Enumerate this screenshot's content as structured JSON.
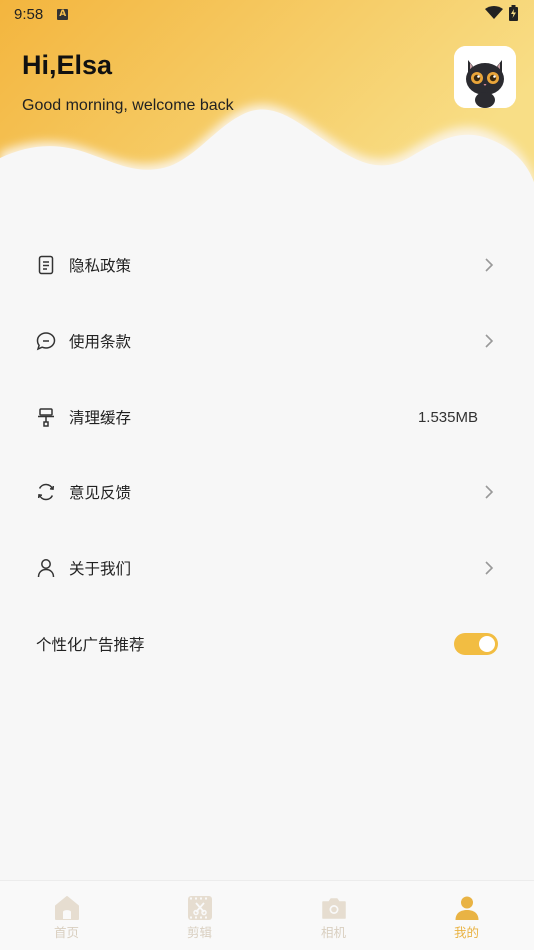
{
  "status_bar": {
    "time": "9:58",
    "notification_icon": "a-notification-icon",
    "wifi_icon": "wifi-icon",
    "battery_icon": "battery-charging-icon"
  },
  "header": {
    "greeting": "Hi,Elsa",
    "subtitle": "Good morning, welcome back",
    "avatar": "black-cat-avatar",
    "gradient_start": "#f3b53e",
    "gradient_end": "#f8de86"
  },
  "menu": {
    "items": [
      {
        "label": "隐私政策",
        "icon": "document-icon",
        "has_arrow": true
      },
      {
        "label": "使用条款",
        "icon": "chat-bubble-icon",
        "has_arrow": true
      },
      {
        "label": "清理缓存",
        "icon": "broom-icon",
        "value": "1.535MB"
      },
      {
        "label": "意见反馈",
        "icon": "refresh-icon",
        "has_arrow": true
      },
      {
        "label": "关于我们",
        "icon": "person-icon",
        "has_arrow": true
      }
    ],
    "toggle": {
      "label": "个性化广告推荐",
      "on": true
    }
  },
  "tabbar": {
    "tabs": [
      {
        "label": "首页",
        "icon": "home-icon",
        "active": false
      },
      {
        "label": "剪辑",
        "icon": "scissors-icon",
        "active": false
      },
      {
        "label": "相机",
        "icon": "camera-icon",
        "active": false
      },
      {
        "label": "我的",
        "icon": "profile-icon",
        "active": true
      }
    ],
    "accent": "#e9b344"
  }
}
